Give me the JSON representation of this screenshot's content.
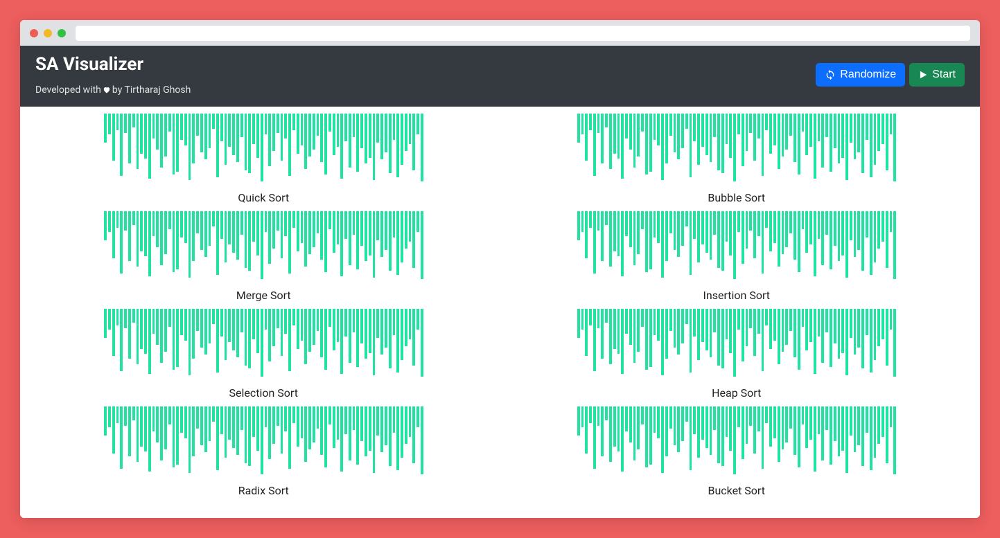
{
  "header": {
    "app_title": "SA Visualizer",
    "credit_prefix": "Developed with",
    "credit_suffix": "by Tirtharaj Ghosh",
    "randomize_label": "Randomize",
    "start_label": "Start"
  },
  "colors": {
    "bar": "#20e3a2",
    "header_bg": "#343a40",
    "primary": "#0d6efd",
    "success": "#198754",
    "page_bg": "#ed5e5e"
  },
  "bar_data": [
    42,
    30,
    68,
    24,
    90,
    28,
    72,
    20,
    80,
    58,
    65,
    94,
    36,
    52,
    78,
    62,
    26,
    88,
    84,
    38,
    46,
    96,
    72,
    32,
    56,
    66,
    50,
    22,
    92,
    40,
    74,
    48,
    60,
    70,
    34,
    82,
    86,
    44,
    64,
    98,
    30,
    76,
    54,
    28,
    68,
    36,
    90,
    24,
    58,
    46,
    80,
    62,
    52,
    32,
    70,
    88,
    26,
    60,
    48,
    94,
    40,
    78,
    34,
    84,
    50,
    72,
    64,
    96,
    42,
    66,
    56,
    86,
    38,
    92,
    74,
    54,
    44,
    82,
    30,
    98
  ],
  "panels": [
    {
      "title": "Quick Sort"
    },
    {
      "title": "Bubble Sort"
    },
    {
      "title": "Merge Sort"
    },
    {
      "title": "Insertion Sort"
    },
    {
      "title": "Selection Sort"
    },
    {
      "title": "Heap Sort"
    },
    {
      "title": "Radix Sort"
    },
    {
      "title": "Bucket Sort"
    }
  ]
}
